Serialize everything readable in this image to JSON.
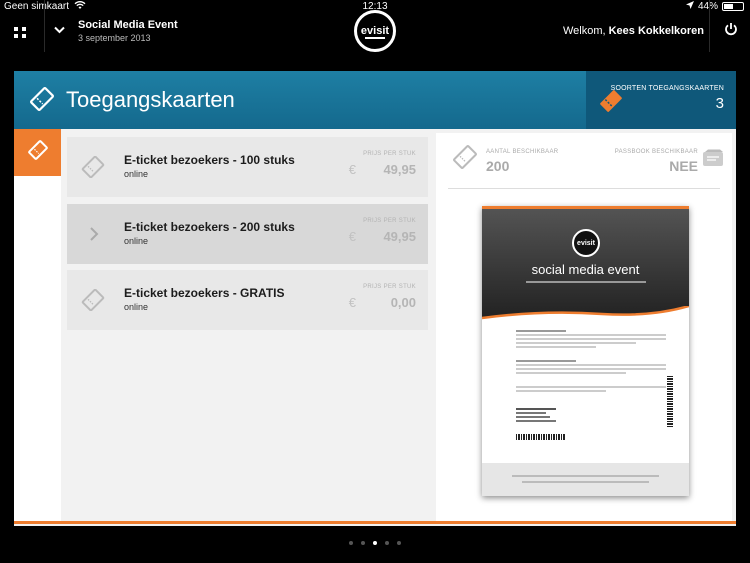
{
  "statusbar": {
    "carrier": "Geen simkaart",
    "time": "12:13",
    "battery": "44%",
    "battery_level": 0.44
  },
  "header": {
    "event_title": "Social Media Event",
    "event_date": "3 september 2013",
    "logo_text": "evisit",
    "welcome_prefix": "Welkom, ",
    "user_name": "Kees Kokkelkoren"
  },
  "page": {
    "title": "Toegangskaarten",
    "types_label": "SOORTEN TOEGANGSKAARTEN",
    "types_count": "3"
  },
  "tickets": [
    {
      "name": "E-ticket bezoekers - 100 stuks",
      "channel": "online",
      "price_label": "PRIJS PER STUK",
      "currency": "€",
      "price": "49,95",
      "selected": false
    },
    {
      "name": "E-ticket bezoekers - 200 stuks",
      "channel": "online",
      "price_label": "PRIJS PER STUK",
      "currency": "€",
      "price": "49,95",
      "selected": true
    },
    {
      "name": "E-ticket bezoekers - GRATIS",
      "channel": "online",
      "price_label": "PRIJS PER STUK",
      "currency": "€",
      "price": "0,00",
      "selected": false
    }
  ],
  "detail": {
    "available_label": "AANTAL BESCHIKBAAR",
    "available_value": "200",
    "passbook_label": "PASSBOOK BESCHIKBAAR",
    "passbook_value": "NEE"
  },
  "ticket_preview": {
    "logo_text": "evisit",
    "event_name": "social media event"
  },
  "pager": {
    "count": 5,
    "active_index": 2
  },
  "colors": {
    "accent": "#ee7d2f",
    "titlebar": "#1a77a0",
    "types_box": "#0f587a"
  }
}
